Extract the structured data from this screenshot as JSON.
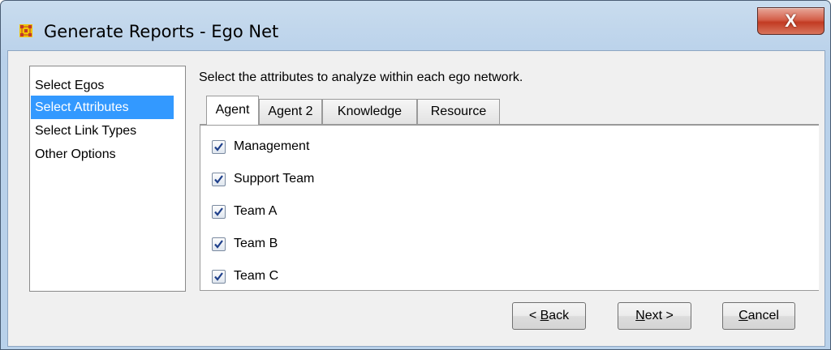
{
  "window": {
    "title": "Generate Reports - Ego Net",
    "close_label": "X"
  },
  "nav": {
    "items": [
      {
        "label": "Select Egos",
        "selected": false
      },
      {
        "label": "Select Attributes",
        "selected": true
      },
      {
        "label": "Select Link Types",
        "selected": false
      },
      {
        "label": "Other Options",
        "selected": false
      }
    ]
  },
  "main": {
    "instruction": "Select the attributes to analyze within each ego network.",
    "tabs": [
      {
        "label": "Agent",
        "active": true
      },
      {
        "label": "Agent 2",
        "active": false
      },
      {
        "label": "Knowledge",
        "active": false
      },
      {
        "label": "Resource",
        "active": false
      }
    ],
    "attributes": [
      {
        "label": "Management",
        "checked": true
      },
      {
        "label": "Support Team",
        "checked": true
      },
      {
        "label": "Team A",
        "checked": true
      },
      {
        "label": "Team B",
        "checked": true
      },
      {
        "label": "Team C",
        "checked": true
      }
    ]
  },
  "buttons": {
    "back": {
      "prefix": "< ",
      "mnemonic": "B",
      "rest": "ack"
    },
    "next": {
      "mnemonic": "N",
      "rest": "ext >"
    },
    "cancel": {
      "mnemonic": "C",
      "rest": "ancel"
    }
  },
  "colors": {
    "selection": "#3399ff",
    "check_mark": "#1e3f8a",
    "close_button": "#c7432a"
  }
}
